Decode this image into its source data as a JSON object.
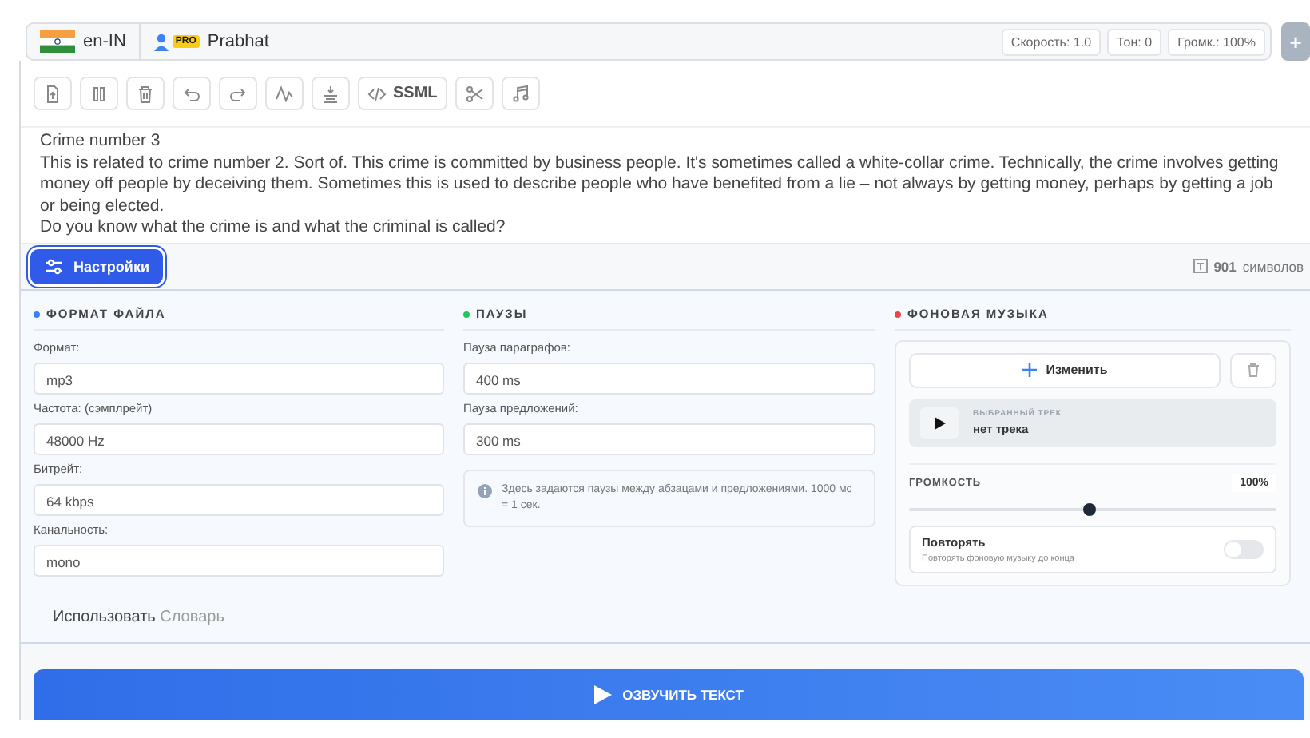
{
  "topbar": {
    "language": "en-IN",
    "badge": "PRO",
    "user": "Prabhat",
    "chips": [
      "Скорость: 1.0",
      "Тон: 0",
      "Громк.: 100%"
    ],
    "add_button": "+"
  },
  "toolbar": {
    "ssml_label": "SSML"
  },
  "text_lines": [
    "Crime number 3",
    "This is related to crime number 2. Sort of. This crime is committed by business people. It's sometimes called a white-collar crime. Technically, the crime involves getting money off people by deceiving them. Sometimes this is used to describe people who have benefited from a lie – not always by getting money, perhaps by getting a job or being elected.",
    "Do you know what the crime is and what the criminal is called?"
  ],
  "settings_button": {
    "label": "Настройки",
    "selected": true
  },
  "char_count": {
    "number": "901",
    "unit": "символов"
  },
  "sections": [
    {
      "title": "ФОРМАТ ФАЙЛА",
      "color": "#3b82f6",
      "fields": [
        {
          "label": "Формат:",
          "value": "mp3"
        },
        {
          "label": "Частота: (сэмплрейт)",
          "value": "48000 Hz"
        },
        {
          "label": "Битрейт:",
          "value": "64 kbps"
        },
        {
          "label": "Канальность:",
          "value": "mono"
        }
      ]
    },
    {
      "title": "ПАУЗЫ",
      "color": "#22c55e",
      "fields": [
        {
          "label": "Пауза параграфов:",
          "value": "400 ms"
        },
        {
          "label": "Пауза предложений:",
          "value": "300 ms"
        }
      ],
      "note": "Здесь задаются паузы между абзацами и предложениями. 1000 мс = 1 сек."
    },
    {
      "title": "ФОНОВАЯ МУЗЫКА",
      "color": "#ef4444"
    }
  ],
  "music": {
    "change_button": "Изменить",
    "track_caption": "ВЫБРАННЫЙ ТРЕК",
    "track_name": "нет трека",
    "volume_label": "ГРОМКОСТЬ",
    "volume_reading": "100%",
    "level": 0.49,
    "repeat_title": "Повторять",
    "repeat_hint": "Повторять фоновую музыку до конца",
    "on": false
  },
  "dictionary": {
    "prefix": "Использовать",
    "link": "Словарь"
  },
  "speak_button": "ОЗВУЧИТЬ ТЕКСТ"
}
